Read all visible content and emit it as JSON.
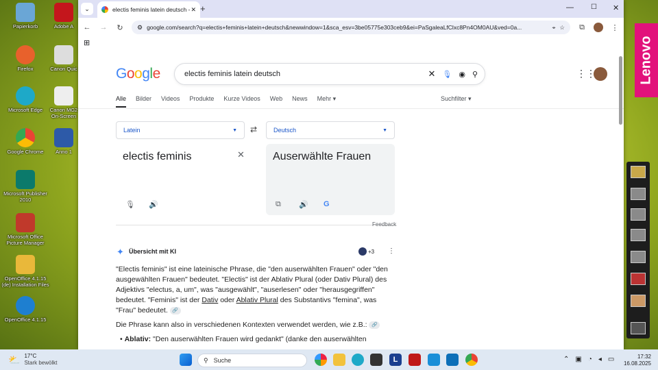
{
  "desktop": {
    "icons": [
      {
        "label": "Papierkorb",
        "color": "#6aa6d6"
      },
      {
        "label": "Firefox",
        "color": "#e8612c"
      },
      {
        "label": "Microsoft Edge",
        "color": "#1ea9c8"
      },
      {
        "label": "Google Chrome",
        "color": "#4285f4"
      },
      {
        "label": "Microsoft Publisher 2010",
        "color": "#0b7a6b"
      },
      {
        "label": "Microsoft Office Picture Manager",
        "color": "#c0392b"
      },
      {
        "label": "OpenOffice 4.1.15 (de) Installation Files",
        "color": "#e9b83a"
      },
      {
        "label": "OpenOffice 4.1.15",
        "color": "#1e7fd0"
      }
    ],
    "icons2": [
      {
        "label": "Adobe A"
      },
      {
        "label": "Canon Quic"
      },
      {
        "label": "Canon MG2 On-Screen"
      },
      {
        "label": "Anno 1"
      }
    ]
  },
  "browser": {
    "tab_title": "electis feminis latein deutsch - G",
    "url": "google.com/search?q=electis+feminis+latein+deutsch&newwindow=1&sca_esv=3be05775e303ceb9&ei=PaSgaleaLfClxc8Pn4OM0AU&ved=0a..."
  },
  "google": {
    "logo": "Google",
    "query": "electis feminis latein deutsch",
    "tabs": [
      "Alle",
      "Bilder",
      "Videos",
      "Produkte",
      "Kurze Videos",
      "Web",
      "News",
      "Mehr"
    ],
    "suchfilter": "Suchfilter"
  },
  "translator": {
    "source_lang": "Latein",
    "target_lang": "Deutsch",
    "source_text": "electis feminis",
    "target_text": "Auserwählte Frauen",
    "feedback": "Feedback"
  },
  "ai_overview": {
    "title": "Übersicht mit KI",
    "sources": "+3",
    "p1_a": "\"Electis feminis\" ist eine lateinische Phrase, die \"den auserwählten Frauen\" oder \"den ausgewählten Frauen\" bedeutet. \"Electis\" ist der Ablativ Plural (oder Dativ Plural) des Adjektivs \"electus, a, um\", was \"ausgewählt\", \"auserlesen\" oder \"herausgegriffen\" bedeutet. \"Feminis\" ist der ",
    "p1_link1": "Dativ",
    "p1_mid": " oder ",
    "p1_link2": "Ablativ Plural",
    "p1_b": " des Substantivs \"femina\", was \"Frau\" bedeutet.",
    "p2": "Die Phrase kann also in verschiedenen Kontexten verwendet werden, wie z.B.:",
    "bullet_label": "Ablativ:",
    "bullet_text": " \"Den auserwählten Frauen wird gedankt\" (danke den auserwählten"
  },
  "side": {
    "brand": "Lenovo"
  },
  "taskbar": {
    "weather_temp": "17°C",
    "weather_text": "Stark bewölkt",
    "search": "Suche",
    "time": "17:32",
    "date": "16.08.2025"
  }
}
